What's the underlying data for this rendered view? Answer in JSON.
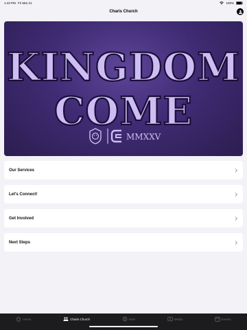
{
  "status_bar": {
    "time": "1:43 PM",
    "date": "Fri Mar 21",
    "battery": "100%"
  },
  "header": {
    "title": "Charis Church"
  },
  "banner": {
    "line1": "KINGDOM",
    "line2": "COME",
    "year": "MMXXV"
  },
  "menu": [
    {
      "label": "Our Services"
    },
    {
      "label": "Let's Connect!"
    },
    {
      "label": "Get Involved"
    },
    {
      "label": "Next Steps"
    }
  ],
  "tabs": [
    {
      "label": "Home",
      "icon": "home-icon",
      "active": false
    },
    {
      "label": "Charis Church",
      "icon": "people-icon",
      "active": true
    },
    {
      "label": "Give",
      "icon": "give-icon",
      "active": false
    },
    {
      "label": "Media",
      "icon": "play-icon",
      "active": false
    },
    {
      "label": "Events",
      "icon": "calendar-icon",
      "active": false
    }
  ],
  "colors": {
    "banner_bg": "#3a2570",
    "banner_text": "#c9b8f0",
    "tab_bar_bg": "#1c1c1e",
    "page_bg": "#f2f2f7"
  }
}
